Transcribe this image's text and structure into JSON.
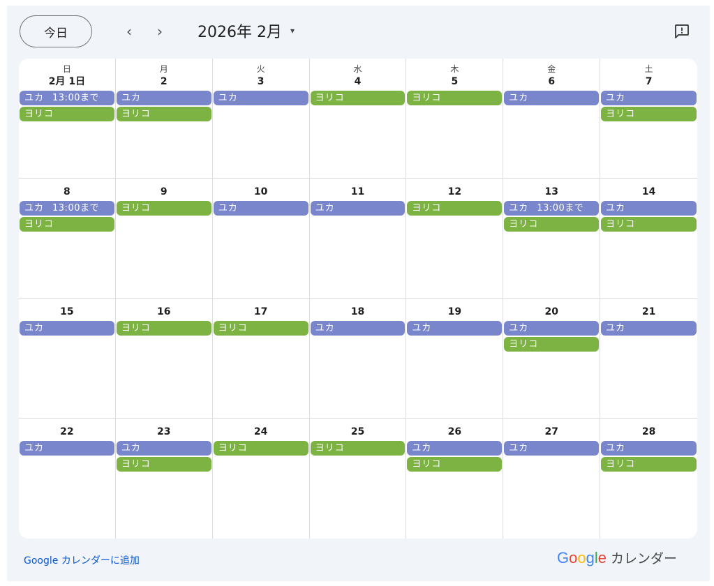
{
  "header": {
    "today_label": "今日",
    "prev_label": "‹",
    "next_label": "›",
    "month_title": "2026年 2月",
    "month_caret": "▾"
  },
  "weekdays": [
    "日",
    "月",
    "火",
    "水",
    "木",
    "金",
    "土"
  ],
  "weeks": [
    [
      {
        "date": "2月 1日",
        "events": [
          {
            "title": "ユカ",
            "time": "13:00まで",
            "color": "blue"
          },
          {
            "title": "ヨリコ",
            "color": "green"
          }
        ]
      },
      {
        "date": "2",
        "events": [
          {
            "title": "ユカ",
            "color": "blue"
          },
          {
            "title": "ヨリコ",
            "color": "green"
          }
        ]
      },
      {
        "date": "3",
        "events": [
          {
            "title": "ユカ",
            "color": "blue"
          }
        ]
      },
      {
        "date": "4",
        "events": [
          {
            "title": "ヨリコ",
            "color": "green"
          }
        ]
      },
      {
        "date": "5",
        "events": [
          {
            "title": "ヨリコ",
            "color": "green"
          }
        ]
      },
      {
        "date": "6",
        "events": [
          {
            "title": "ユカ",
            "color": "blue"
          }
        ]
      },
      {
        "date": "7",
        "events": [
          {
            "title": "ユカ",
            "color": "blue"
          },
          {
            "title": "ヨリコ",
            "color": "green"
          }
        ]
      }
    ],
    [
      {
        "date": "8",
        "events": [
          {
            "title": "ユカ",
            "time": "13:00まで",
            "color": "blue"
          },
          {
            "title": "ヨリコ",
            "color": "green"
          }
        ]
      },
      {
        "date": "9",
        "events": [
          {
            "title": "ヨリコ",
            "color": "green"
          }
        ]
      },
      {
        "date": "10",
        "events": [
          {
            "title": "ユカ",
            "color": "blue"
          }
        ]
      },
      {
        "date": "11",
        "events": [
          {
            "title": "ユカ",
            "color": "blue"
          }
        ]
      },
      {
        "date": "12",
        "events": [
          {
            "title": "ヨリコ",
            "color": "green"
          }
        ]
      },
      {
        "date": "13",
        "events": [
          {
            "title": "ユカ",
            "time": "13:00まで",
            "color": "blue"
          },
          {
            "title": "ヨリコ",
            "color": "green"
          }
        ]
      },
      {
        "date": "14",
        "events": [
          {
            "title": "ユカ",
            "color": "blue"
          },
          {
            "title": "ヨリコ",
            "color": "green"
          }
        ]
      }
    ],
    [
      {
        "date": "15",
        "events": [
          {
            "title": "ユカ",
            "color": "blue"
          }
        ]
      },
      {
        "date": "16",
        "events": [
          {
            "title": "ヨリコ",
            "color": "green"
          }
        ]
      },
      {
        "date": "17",
        "events": [
          {
            "title": "ヨリコ",
            "color": "green"
          }
        ]
      },
      {
        "date": "18",
        "events": [
          {
            "title": "ユカ",
            "color": "blue"
          }
        ]
      },
      {
        "date": "19",
        "events": [
          {
            "title": "ユカ",
            "color": "blue"
          }
        ]
      },
      {
        "date": "20",
        "events": [
          {
            "title": "ユカ",
            "color": "blue"
          },
          {
            "title": "ヨリコ",
            "color": "green"
          }
        ]
      },
      {
        "date": "21",
        "events": [
          {
            "title": "ユカ",
            "color": "blue"
          }
        ]
      }
    ],
    [
      {
        "date": "22",
        "events": [
          {
            "title": "ユカ",
            "color": "blue"
          }
        ]
      },
      {
        "date": "23",
        "events": [
          {
            "title": "ユカ",
            "color": "blue"
          },
          {
            "title": "ヨリコ",
            "color": "green"
          }
        ]
      },
      {
        "date": "24",
        "events": [
          {
            "title": "ヨリコ",
            "color": "green"
          }
        ]
      },
      {
        "date": "25",
        "events": [
          {
            "title": "ヨリコ",
            "color": "green"
          }
        ]
      },
      {
        "date": "26",
        "events": [
          {
            "title": "ユカ",
            "color": "blue"
          },
          {
            "title": "ヨリコ",
            "color": "green"
          }
        ]
      },
      {
        "date": "27",
        "events": [
          {
            "title": "ユカ",
            "color": "blue"
          }
        ]
      },
      {
        "date": "28",
        "events": [
          {
            "title": "ユカ",
            "color": "blue"
          },
          {
            "title": "ヨリコ",
            "color": "green"
          }
        ]
      }
    ]
  ],
  "footer": {
    "add_link": "Google カレンダーに追加",
    "brand_letters": [
      "G",
      "o",
      "o",
      "g",
      "l",
      "e"
    ],
    "brand_text": "カレンダー"
  },
  "colors": {
    "blue": "#7986cb",
    "green": "#7cb342",
    "link": "#0b57d0",
    "background": "#f1f4f9"
  },
  "icons": {
    "feedback": "feedback-icon",
    "prev": "chevron-left-icon",
    "next": "chevron-right-icon",
    "caret": "caret-down-icon"
  }
}
